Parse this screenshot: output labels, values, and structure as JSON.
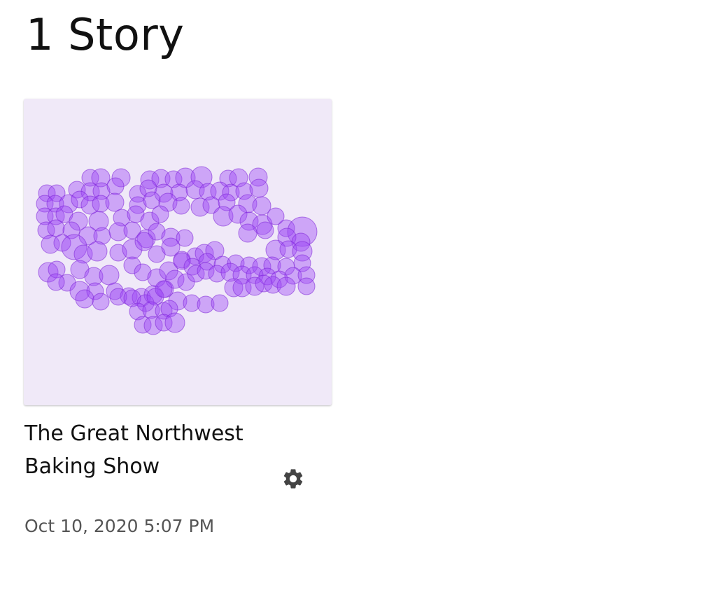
{
  "page": {
    "title": "1 Story"
  },
  "stories": [
    {
      "title": "The Great Northwest Baking Show",
      "date": "Oct 10, 2020 5:07 PM",
      "settings_icon": "gear-icon",
      "thumbnail_colors": {
        "background": "#f0e9f8",
        "bubble_fill": "#9d47f5",
        "bubble_stroke": "#7a1fd6"
      }
    }
  ]
}
